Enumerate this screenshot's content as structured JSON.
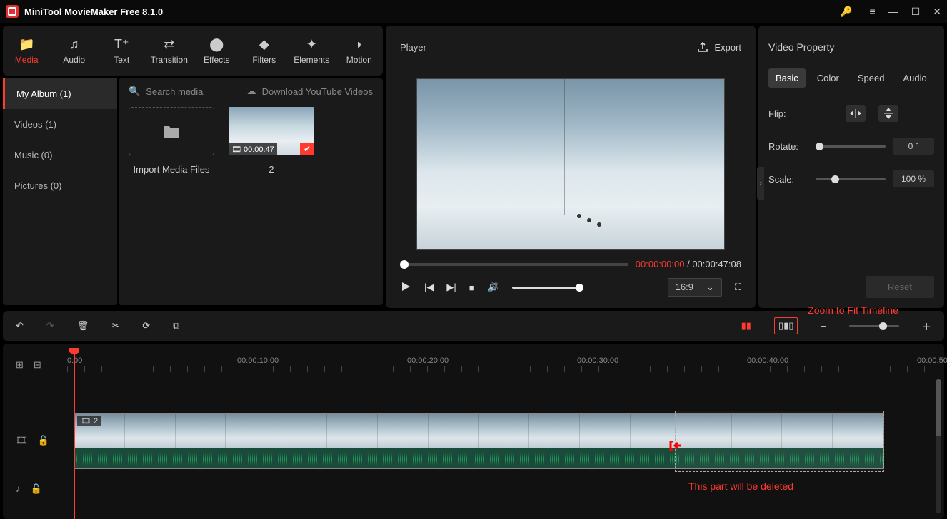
{
  "app": {
    "title": "MiniTool MovieMaker Free 8.1.0"
  },
  "tabs": {
    "media": "Media",
    "audio": "Audio",
    "text": "Text",
    "transition": "Transition",
    "effects": "Effects",
    "filters": "Filters",
    "elements": "Elements",
    "motion": "Motion"
  },
  "sidebar": {
    "album": "My Album (1)",
    "videos": "Videos (1)",
    "music": "Music (0)",
    "pictures": "Pictures (0)"
  },
  "media": {
    "search": "Search media",
    "dl_yt": "Download YouTube Videos",
    "import": "Import Media Files",
    "clip_dur": "00:00:47",
    "clip_count": "2"
  },
  "player": {
    "title": "Player",
    "export": "Export",
    "cur": "00:00:00:00",
    "total": "00:00:47:08",
    "sep": " / ",
    "aspect": "16:9"
  },
  "props": {
    "title": "Video Property",
    "basic": "Basic",
    "color": "Color",
    "speed": "Speed",
    "audio": "Audio",
    "flip": "Flip:",
    "rotate": "Rotate:",
    "rotate_v": "0 °",
    "scale": "Scale:",
    "scale_v": "100 %",
    "reset": "Reset"
  },
  "annot": {
    "zoom": "Zoom to Fit Timeline",
    "del": "This part will be deleted"
  },
  "ruler": {
    "t0": "0:00",
    "t1": "00:00:10:00",
    "t2": "00:00:20:00",
    "t3": "00:00:30:00",
    "t4": "00:00:40:00",
    "t5": "00:00:50"
  },
  "clipbadge": "2"
}
